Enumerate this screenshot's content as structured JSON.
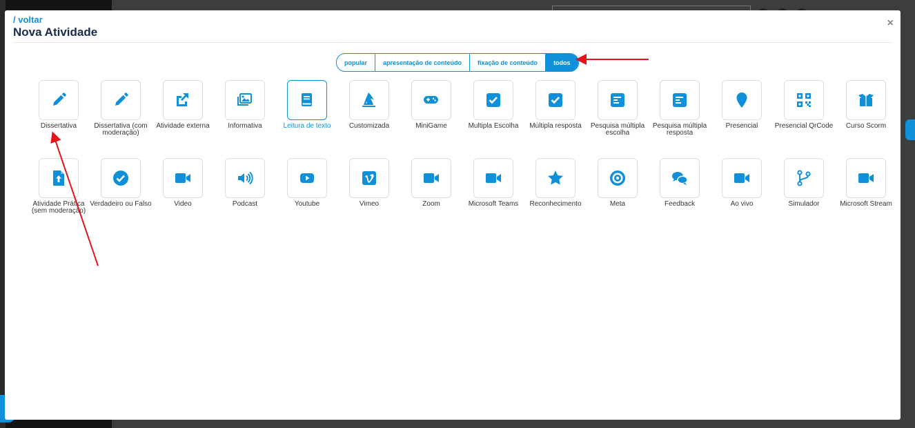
{
  "modal": {
    "back_label": "/ voltar",
    "title": "Nova Atividade",
    "close_glyph": "×"
  },
  "filters": [
    {
      "label": "popular",
      "active": false
    },
    {
      "label": "apresentação de conteúdo",
      "active": false
    },
    {
      "label": "fixação de conteúdo",
      "active": false
    },
    {
      "label": "todos",
      "active": true
    }
  ],
  "activities_row1": [
    {
      "label": "Dissertativa",
      "icon": "pencil-icon"
    },
    {
      "label": "Dissertativa (com moderação)",
      "icon": "pencil-icon"
    },
    {
      "label": "Atividade externa",
      "icon": "external-link-icon"
    },
    {
      "label": "Informativa",
      "icon": "images-icon"
    },
    {
      "label": "Leitura de texto",
      "icon": "book-icon",
      "selected": true
    },
    {
      "label": "Customizada",
      "icon": "wizard-hat-icon"
    },
    {
      "label": "MiniGame",
      "icon": "gamepad-icon"
    },
    {
      "label": "Multipla Escolha",
      "icon": "checkbox-icon"
    },
    {
      "label": "Múltipla resposta",
      "icon": "checkbox-icon"
    },
    {
      "label": "Pesquisa múltipla escolha",
      "icon": "poll-icon"
    },
    {
      "label": "Pesquisa múltipla resposta",
      "icon": "poll-icon"
    },
    {
      "label": "Presencial",
      "icon": "map-marker-icon"
    },
    {
      "label": "Presencial QrCode",
      "icon": "qrcode-icon"
    },
    {
      "label": "Curso Scorm",
      "icon": "box-open-icon"
    }
  ],
  "activities_row2": [
    {
      "label": "Atividade Prática (sem moderação)",
      "icon": "file-upload-icon"
    },
    {
      "label": "Verdadeiro ou Falso",
      "icon": "check-circle-icon"
    },
    {
      "label": "Video",
      "icon": "video-camera-icon"
    },
    {
      "label": "Podcast",
      "icon": "speaker-icon"
    },
    {
      "label": "Youtube",
      "icon": "youtube-icon"
    },
    {
      "label": "Vimeo",
      "icon": "vimeo-icon"
    },
    {
      "label": "Zoom",
      "icon": "video-camera-icon"
    },
    {
      "label": "Microsoft Teams",
      "icon": "video-camera-icon"
    },
    {
      "label": "Reconhecimento",
      "icon": "star-icon"
    },
    {
      "label": "Meta",
      "icon": "target-icon"
    },
    {
      "label": "Feedback",
      "icon": "comments-icon"
    },
    {
      "label": "Ao vivo",
      "icon": "video-camera-icon"
    },
    {
      "label": "Simulador",
      "icon": "code-branch-icon"
    },
    {
      "label": "Microsoft Stream",
      "icon": "video-camera-icon"
    }
  ],
  "colors": {
    "accent": "#0f90d8",
    "annotation_arrow": "#e3131b",
    "title": "#1b2a4a"
  }
}
